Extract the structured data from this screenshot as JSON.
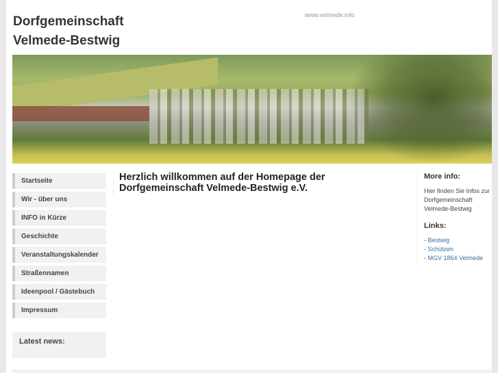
{
  "header": {
    "title_line1": "Dorfgemeinschaft",
    "title_line2": "Velmede-Bestwig",
    "url": "www.velmede.info"
  },
  "nav": [
    "Startseite",
    "Wir - über uns",
    "INFO in Kürze",
    "Geschichte",
    "Veranstaltungskalender",
    "Straßennamen",
    "Ideenpool / Gästebuch",
    "Impressum"
  ],
  "news": {
    "title": "Latest news:"
  },
  "main": {
    "heading_line1": "Herzlich willkommen auf der Homepage der",
    "heading_line2": "Dorfgemeinschaft Velmede-Bestwig e.V."
  },
  "side": {
    "more_title": "More info:",
    "more_text": "Hier finden Sie Infos zur Dorfgemeinschaft Velmede-Bestwig",
    "links_title": "Links:",
    "links": [
      "Bestwig",
      "Schützen",
      "MGV 1864 Velmede"
    ]
  }
}
